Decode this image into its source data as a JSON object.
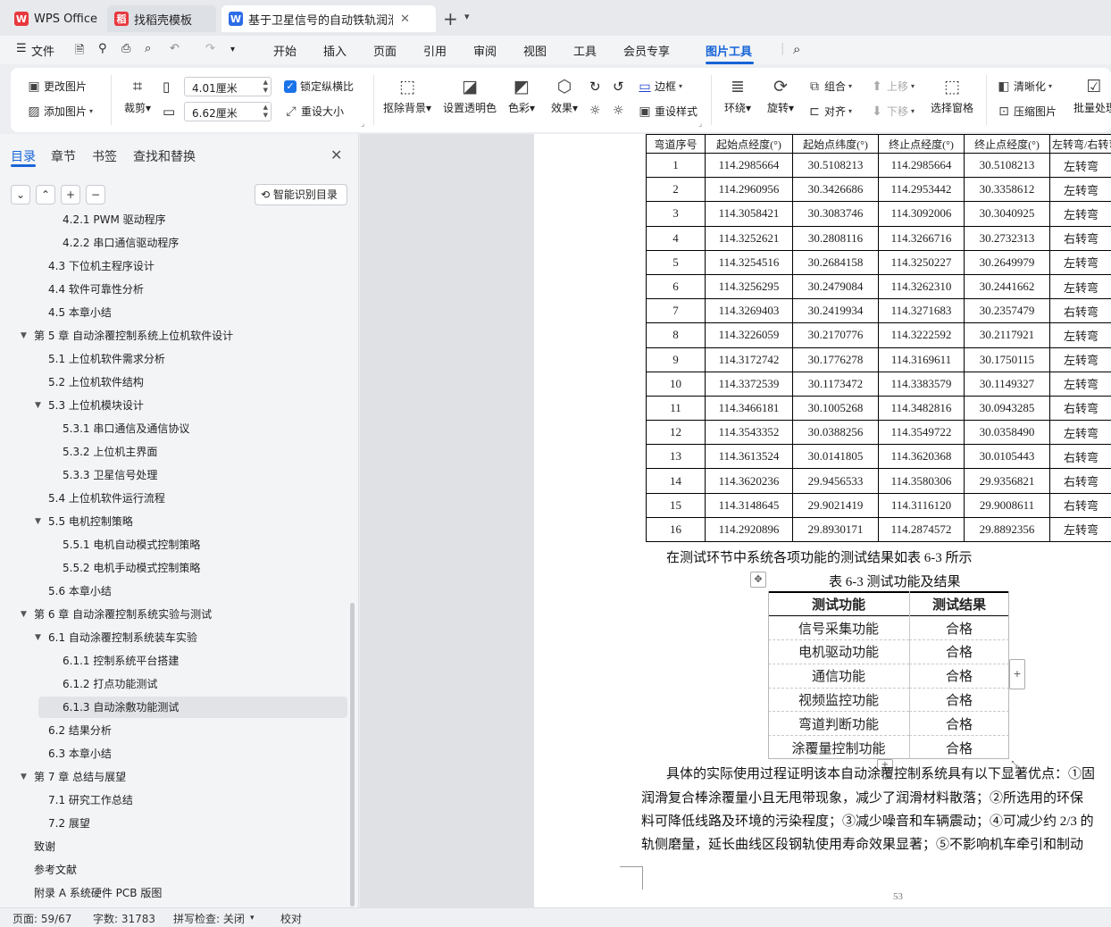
{
  "tabs": [
    {
      "label": "WPS Office",
      "logo": "W",
      "logo_color": "#e8383d"
    },
    {
      "label": "找稻壳模板",
      "logo": "稻",
      "logo_color": "#e8383d"
    },
    {
      "label": "基于卫星信号的自动铁轨润滑",
      "logo": "W",
      "logo_color": "#2d6ce6"
    }
  ],
  "menu": {
    "file": "文件",
    "items": [
      "开始",
      "插入",
      "页面",
      "引用",
      "审阅",
      "视图",
      "工具",
      "会员专享",
      "图片工具"
    ]
  },
  "ribbon": {
    "change_picture": "更改图片",
    "add_picture": "添加图片",
    "crop": "裁剪",
    "width_value": "4.01厘米",
    "height_value": "6.62厘米",
    "lock_ratio": "锁定纵横比",
    "reset_size": "重设大小",
    "remove_bg": "抠除背景",
    "set_transparent": "设置透明色",
    "color": "色彩",
    "effects": "效果",
    "border": "边框",
    "reset_style": "重设样式",
    "wrap": "环绕",
    "rotate": "旋转",
    "group": "组合",
    "align": "对齐",
    "move_up": "上移",
    "move_down": "下移",
    "select_pane": "选择窗格",
    "sharpen": "清晰化",
    "compress": "压缩图片",
    "batch": "批量处理"
  },
  "nav": {
    "tabs": [
      "目录",
      "章节",
      "书签",
      "查找和替换"
    ],
    "smart_toc": "智能识别目录",
    "toc": [
      {
        "text": "4.2.1 PWM 驱动程序",
        "level": 3
      },
      {
        "text": "4.2.2  串口通信驱动程序",
        "level": 3
      },
      {
        "text": "4.3  下位机主程序设计",
        "level": 2
      },
      {
        "text": "4.4  软件可靠性分析",
        "level": 2
      },
      {
        "text": "4.5  本章小结",
        "level": 2
      },
      {
        "text": "第 5 章  自动涂覆控制系统上位机软件设计",
        "level": 1,
        "expand": true
      },
      {
        "text": "5.1  上位机软件需求分析",
        "level": 2
      },
      {
        "text": "5.2  上位机软件结构",
        "level": 2
      },
      {
        "text": "5.3  上位机模块设计",
        "level": 2,
        "expand": true
      },
      {
        "text": "5.3.1  串口通信及通信协议",
        "level": 3
      },
      {
        "text": "5.3.2  上位机主界面",
        "level": 3
      },
      {
        "text": "5.3.3  卫星信号处理",
        "level": 3
      },
      {
        "text": "5.4  上位机软件运行流程",
        "level": 2
      },
      {
        "text": "5.5  电机控制策略",
        "level": 2,
        "expand": true
      },
      {
        "text": "5.5.1  电机自动模式控制策略",
        "level": 3
      },
      {
        "text": "5.5.2  电机手动模式控制策略",
        "level": 3
      },
      {
        "text": "5.6  本章小结",
        "level": 2
      },
      {
        "text": "第 6 章  自动涂覆控制系统实验与测试",
        "level": 1,
        "expand": true
      },
      {
        "text": "6.1  自动涂覆控制系统装车实验",
        "level": 2,
        "expand": true
      },
      {
        "text": "6.1.1  控制系统平台搭建",
        "level": 3
      },
      {
        "text": "6.1.2  打点功能测试",
        "level": 3
      },
      {
        "text": "6.1.3  自动涂敷功能测试",
        "level": 3,
        "selected": true
      },
      {
        "text": "6.2  结果分析",
        "level": 2
      },
      {
        "text": "6.3  本章小结",
        "level": 2
      },
      {
        "text": "第 7 章  总结与展望",
        "level": 1,
        "expand": true
      },
      {
        "text": "7.1  研究工作总结",
        "level": 2
      },
      {
        "text": "7.2  展望",
        "level": 2
      },
      {
        "text": "致谢",
        "level": 1
      },
      {
        "text": "参考文献",
        "level": 1
      },
      {
        "text": "附录 A  系统硬件 PCB 版图",
        "level": 1
      }
    ]
  },
  "doc": {
    "coord_table": {
      "headers": [
        "弯道序号",
        "起始点经度(°)",
        "起始点纬度(°)",
        "终止点经度(°)",
        "终止点经度(°)",
        "左转弯/右转弯"
      ],
      "rows": [
        [
          "1",
          "114.2985664",
          "30.5108213",
          "114.2985664",
          "30.5108213",
          "左转弯"
        ],
        [
          "2",
          "114.2960956",
          "30.3426686",
          "114.2953442",
          "30.3358612",
          "左转弯"
        ],
        [
          "3",
          "114.3058421",
          "30.3083746",
          "114.3092006",
          "30.3040925",
          "左转弯"
        ],
        [
          "4",
          "114.3252621",
          "30.2808116",
          "114.3266716",
          "30.2732313",
          "右转弯"
        ],
        [
          "5",
          "114.3254516",
          "30.2684158",
          "114.3250227",
          "30.2649979",
          "左转弯"
        ],
        [
          "6",
          "114.3256295",
          "30.2479084",
          "114.3262310",
          "30.2441662",
          "左转弯"
        ],
        [
          "7",
          "114.3269403",
          "30.2419934",
          "114.3271683",
          "30.2357479",
          "右转弯"
        ],
        [
          "8",
          "114.3226059",
          "30.2170776",
          "114.3222592",
          "30.2117921",
          "左转弯"
        ],
        [
          "9",
          "114.3172742",
          "30.1776278",
          "114.3169611",
          "30.1750115",
          "左转弯"
        ],
        [
          "10",
          "114.3372539",
          "30.1173472",
          "114.3383579",
          "30.1149327",
          "左转弯"
        ],
        [
          "11",
          "114.3466181",
          "30.1005268",
          "114.3482816",
          "30.0943285",
          "右转弯"
        ],
        [
          "12",
          "114.3543352",
          "30.0388256",
          "114.3549722",
          "30.0358490",
          "左转弯"
        ],
        [
          "13",
          "114.3613524",
          "30.0141805",
          "114.3620368",
          "30.0105443",
          "右转弯"
        ],
        [
          "14",
          "114.3620236",
          "29.9456533",
          "114.3580306",
          "29.9356821",
          "右转弯"
        ],
        [
          "15",
          "114.3148645",
          "29.9021419",
          "114.3116120",
          "29.9008611",
          "右转弯"
        ],
        [
          "16",
          "114.2920896",
          "29.8930171",
          "114.2874572",
          "29.8892356",
          "左转弯"
        ]
      ]
    },
    "intro_text": "在测试环节中系统各项功能的测试结果如表 6-3 所示",
    "func_caption": "表 6-3  测试功能及结果",
    "func_table": {
      "headers": [
        "测试功能",
        "测试结果"
      ],
      "rows": [
        [
          "信号采集功能",
          "合格"
        ],
        [
          "电机驱动功能",
          "合格"
        ],
        [
          "通信功能",
          "合格"
        ],
        [
          "视频监控功能",
          "合格"
        ],
        [
          "弯道判断功能",
          "合格"
        ],
        [
          "涂覆量控制功能",
          "合格"
        ]
      ]
    },
    "para_lines": [
      "具体的实际使用过程证明该本自动涂覆控制系统具有以下显著优点：①固",
      "润滑复合棒涂覆量小且无甩带现象，减少了润滑材料散落；②所选用的环保",
      "料可降低线路及环境的污染程度；③减少噪音和车辆震动；④可减少约 2/3 的",
      "轨侧磨量，延长曲线区段钢轨使用寿命效果显著；⑤不影响机车牵引和制动"
    ],
    "page_number": "53"
  },
  "status": {
    "page": "页面: 59/67",
    "words": "字数: 31783",
    "spell": "拼写检查: 关闭",
    "proof": "校对"
  },
  "colors": {
    "accent": "#1764d8"
  }
}
